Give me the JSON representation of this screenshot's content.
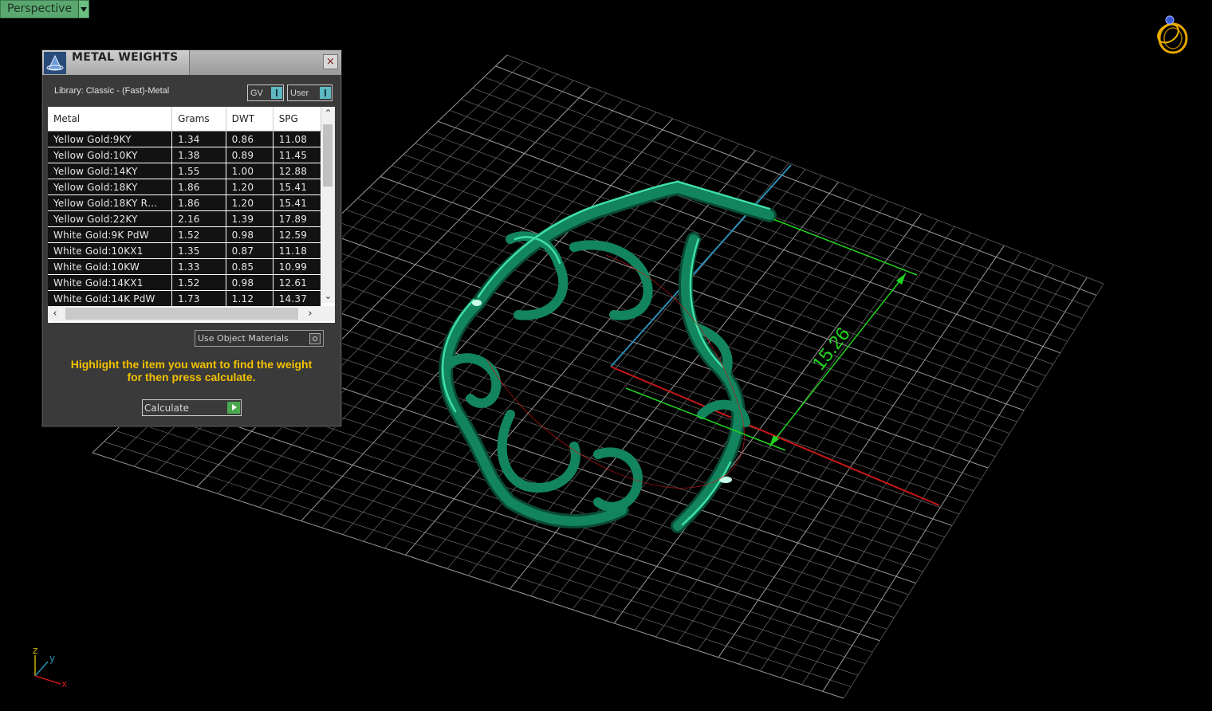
{
  "viewport": {
    "label": "Perspective"
  },
  "panel": {
    "title": "METAL WEIGHTS",
    "close_symbol": "×",
    "library_label": "Library: Classic - (Fast)-Metal",
    "toggle_gv": "GV",
    "toggle_user": "User",
    "table": {
      "headers": [
        "Metal",
        "Grams",
        "DWT",
        "SPG"
      ],
      "rows": [
        [
          "Yellow Gold:9KY",
          "1.34",
          "0.86",
          "11.08"
        ],
        [
          "Yellow Gold:10KY",
          "1.38",
          "0.89",
          "11.45"
        ],
        [
          "Yellow Gold:14KY",
          "1.55",
          "1.00",
          "12.88"
        ],
        [
          "Yellow Gold:18KY",
          "1.86",
          "1.20",
          "15.41"
        ],
        [
          "Yellow Gold:18KY R…",
          "1.86",
          "1.20",
          "15.41"
        ],
        [
          "Yellow Gold:22KY",
          "2.16",
          "1.39",
          "17.89"
        ],
        [
          "White Gold:9K PdW",
          "1.52",
          "0.98",
          "12.59"
        ],
        [
          "White Gold:10KX1",
          "1.35",
          "0.87",
          "11.18"
        ],
        [
          "White Gold:10KW",
          "1.33",
          "0.85",
          "10.99"
        ],
        [
          "White Gold:14KX1",
          "1.52",
          "0.98",
          "12.61"
        ],
        [
          "White Gold:14K PdW",
          "1.73",
          "1.12",
          "14.37"
        ]
      ]
    },
    "use_object_materials": "Use Object Materials",
    "hint_line1": "Highlight the item you want to find the weight",
    "hint_line2": "for then press calculate.",
    "calculate_label": "Calculate"
  },
  "dimension": {
    "value": "15.26"
  },
  "axis_labels": {
    "z": "z",
    "y": "y",
    "x": "x"
  },
  "colors": {
    "model": "#12855f",
    "model_highlight": "#3ee0a5",
    "grid": "#7a7a7a",
    "axis_x": "#c81818",
    "axis_y": "#2b8fb8",
    "dimension": "#22d41e",
    "hint": "#f2c200",
    "viewport_label_bg": "#5aa870"
  }
}
